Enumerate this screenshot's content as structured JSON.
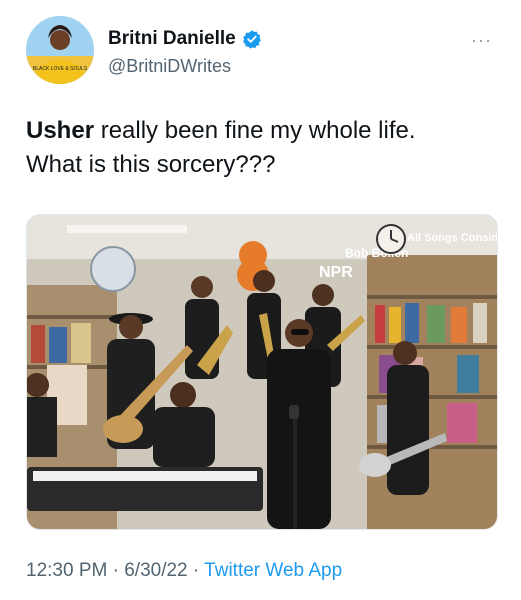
{
  "author": {
    "display_name": "Britni Danielle",
    "handle": "@BritniDWrites",
    "verified_icon": "verified-badge-icon",
    "avatar_shirt_text": "BLACK LOVE & SOULS"
  },
  "more_icon": "more-dots-icon",
  "tweet": {
    "bold_word": "Usher",
    "text_line1_rest": " really been fine my whole life.",
    "text_line2": "What is this sorcery???"
  },
  "media": {
    "sign_text_1": "NPR",
    "sign_text_2": "Bob Boilen",
    "sign_text_3": "All Songs Considered"
  },
  "meta": {
    "time": "12:30 PM",
    "sep1": " · ",
    "date": "6/30/22",
    "sep2": " · ",
    "app": "Twitter Web App"
  },
  "colors": {
    "link": "#1d9bf0",
    "secondary_text": "#536471",
    "verified": "#1d9bf0"
  }
}
